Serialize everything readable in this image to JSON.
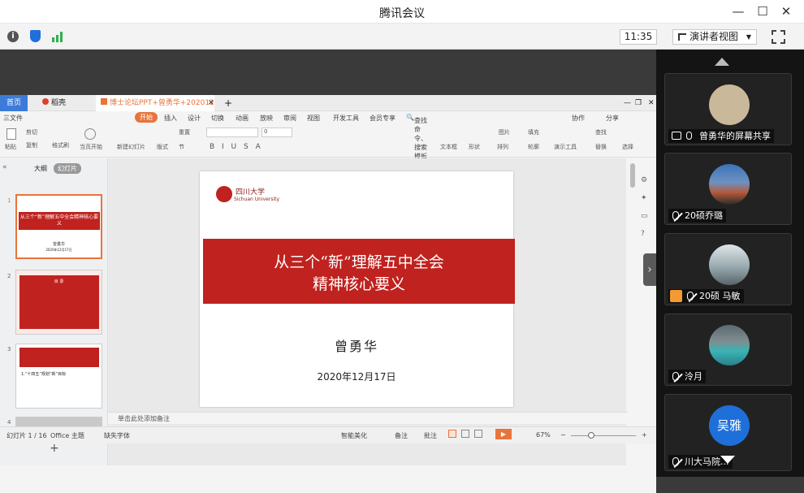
{
  "window": {
    "title": "腾讯会议"
  },
  "toolbar": {
    "time": "11:35",
    "presenter_view": "演讲者视图"
  },
  "wps": {
    "tabs": {
      "home": "首页",
      "daoke": "稻壳",
      "doc": "博士论坛PPT+曾勇华+20201217",
      "add": "+"
    },
    "menu": {
      "file": "三文件",
      "start": "开始",
      "insert": "插入",
      "design": "设计",
      "switch": "切换",
      "animation": "动画",
      "slideshow": "放映",
      "review": "审阅",
      "view": "视图",
      "dev": "开发工具",
      "member": "会员专享",
      "search": "查找命令、搜索模板",
      "collab": "协作",
      "share": "分享"
    },
    "ribbon": {
      "paste": "粘贴",
      "cut": "剪切",
      "copy": "复制",
      "format_painter": "格式刷",
      "from_current": "当页开始",
      "new_slide": "新建幻灯片",
      "layout": "版式",
      "section": "节",
      "reset": "重置",
      "font_size": "0",
      "textbox": "文本框",
      "shape": "形状",
      "arrange": "排列",
      "picture": "图片",
      "fill": "填充",
      "outline": "轮廓",
      "present_tool": "演示工具",
      "find": "查找",
      "replace": "替换",
      "select": "选择"
    },
    "panel_tabs": {
      "outline": "大纲",
      "slides": "幻灯片"
    },
    "thumbs": [
      {
        "num": "1",
        "title": "从三个“新”理解五中全会精神核心要义",
        "author": "曾勇华",
        "date": "2020年12月17日"
      },
      {
        "num": "2",
        "title": "目 录"
      },
      {
        "num": "3",
        "title": "1.“十四五”规划“新”目标"
      },
      {
        "num": "4"
      }
    ],
    "slide": {
      "logo_cn": "四川大学",
      "logo_en": "Sichuan University",
      "title_line1": "从三个“新”理解五中全会",
      "title_line2": "精神核心要义",
      "author": "曾勇华",
      "date": "2020年12月17日"
    },
    "notes_placeholder": "单击此处添加备注",
    "status": {
      "slide_label": "幻灯片 1 / 16",
      "theme": "Office 主题",
      "missing_font": "缺失字体",
      "beautify": "智能美化",
      "notes": "备注",
      "comments": "批注",
      "zoom": "67%"
    }
  },
  "participants": [
    {
      "name": "曾勇华的屏幕共享",
      "avatar_color": "#c9b89a",
      "muted": false,
      "sharing": true
    },
    {
      "name": "20硕乔璐",
      "avatar_color": "#4a7fb5",
      "muted": true
    },
    {
      "name": "20硕 马敏",
      "avatar_color": "#8a9aa0",
      "muted": true,
      "host": true
    },
    {
      "name": "泠月",
      "avatar_color": "#3aa0a0",
      "muted": true
    },
    {
      "name": "川大马院...",
      "avatar_text": "吴雅",
      "avatar_color": "#1e6fd9",
      "muted": true
    }
  ],
  "colors": {
    "accent_red": "#c0221f",
    "wps_orange": "#e8743b",
    "signal_green": "#2bb24c",
    "shield_blue": "#1e6fd9"
  }
}
